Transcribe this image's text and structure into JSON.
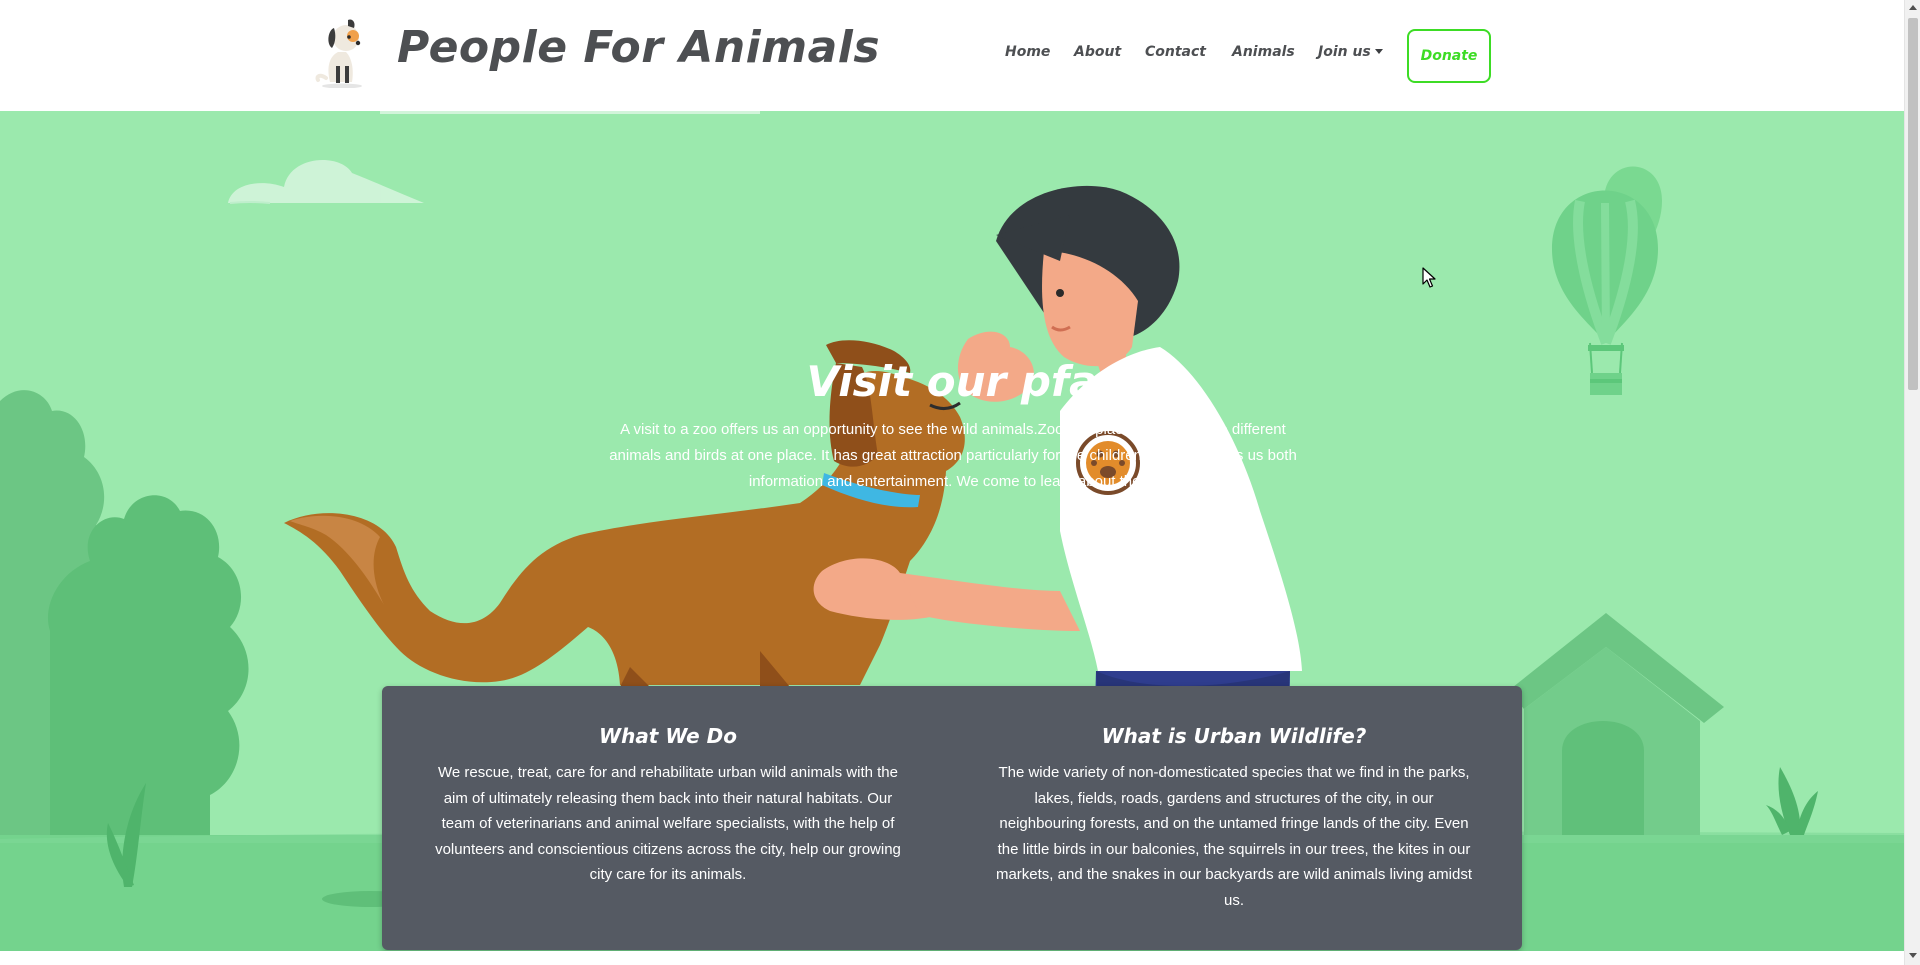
{
  "header": {
    "brand": "People For Animals",
    "logo_icon": "sitting-dog-icon",
    "nav": [
      {
        "label": "Home"
      },
      {
        "label": "About"
      },
      {
        "label": "Contact"
      },
      {
        "label": "Animals"
      },
      {
        "label": "Join us",
        "dropdown": true
      }
    ],
    "donate_label": "Donate"
  },
  "hero": {
    "title": "Visit our pfa",
    "text": "A visit to a zoo offers us an opportunity to see the wild animals.Zoo is a place where we see different animals and birds at one place. It has great attraction particularly for the children. The zoo gives us both information and entertainment. We come to learn about them."
  },
  "info": {
    "left": {
      "title": "What We Do",
      "text": "We rescue, treat, care for and rehabilitate urban wild animals with the aim of ultimately releasing them back into their natural habitats. Our team of veterinarians and animal welfare specialists, with the help of volunteers and conscientious citizens across the city, help our growing city care for its animals."
    },
    "right": {
      "title": "What is Urban Wildlife?",
      "text": "The wide variety of non-domesticated species that we find in the parks, lakes, fields, roads, gardens and structures of the city, in our neighbouring forests, and on the untamed fringe lands of the city. Even the little birds in our balconies, the squirrels in our trees, the kites in our markets, and the snakes in our backyards are wild animals living amidst us."
    }
  },
  "colors": {
    "hero_bg": "#9be9ad",
    "accent_green": "#3ddc25",
    "panel_bg": "#555a63",
    "text_dark": "#4d4f52"
  }
}
